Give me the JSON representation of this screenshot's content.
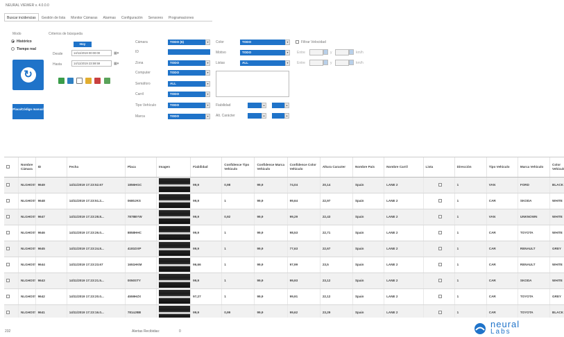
{
  "app": {
    "title": "NEURAL VIEWER v. 4.0.0.0"
  },
  "tabs": [
    "Buscar incidencias",
    "Gestión de lista",
    "Monitor Cámaras",
    "Alarmas",
    "Configuración",
    "Sensores",
    "Programaciones"
  ],
  "mode": {
    "group_label": "Modo",
    "options": [
      {
        "label": "Histórico",
        "selected": true
      },
      {
        "label": "Tiempo real",
        "selected": false
      }
    ]
  },
  "criteria": {
    "group_label": "Criterios de búsqueda",
    "today_button": "Hoy",
    "from_label": "Desde",
    "from_value": "14/11/2019 00:00:00",
    "to_label": "Hasta",
    "to_value": "14/11/2019 23:59:59",
    "camera_label": "Cámara",
    "camera_value": "TODO (6)",
    "id_label": "ID",
    "id_value": "",
    "zone_label": "Zona",
    "zone_value": "TODO",
    "computer_label": "Computer",
    "computer_value": "TODO",
    "traffic_light_label": "Semáforo",
    "traffic_light_value": "ALL",
    "lane_label": "Carril",
    "lane_value": "TODO",
    "vehicle_type_label": "Tipo Vehículo",
    "vehicle_type_value": "TODO",
    "brand_label": "Marca",
    "brand_value": "TODO",
    "color_label": "Color",
    "color_value": "TODO",
    "reason_label": "Motivo",
    "reason_value": "TODO",
    "lists_label": "Listas",
    "lists_value": "ALL",
    "speed_filter_label": "Filtrar Velocidad",
    "between_label": "Entre",
    "and_label": "y",
    "speed_unit": "km/h",
    "speed_min_1": "0",
    "speed_max_1": "0",
    "speed_min_2": "0",
    "speed_max_2": "0",
    "reliability_label": "Fiabilidad",
    "reliability_min": "0",
    "reliability_max": "100",
    "char_height_label": "Alt. Carácter",
    "char_height_min": "0",
    "char_height_max": "100",
    "plate_button": "Placa/Código manual"
  },
  "table": {
    "columns": [
      "Nombre Cámara",
      "ID",
      "Fecha",
      "Placa",
      "Imagen",
      "Fiabilidad",
      "Confidence Tipo Vehiculo",
      "Confidence Marca Vehiculo",
      "Confidence Color Vehiculo",
      "Altura Caracter",
      "Nombre País",
      "Nombre Carril",
      "Lista",
      "Dirección",
      "Tipo Vehiculo",
      "Marca Vehiculo",
      "Color Vehiculo"
    ],
    "rows": [
      [
        "NLGHOST1",
        "9649",
        "14/11/2019 17:23:52.67",
        "1856HGC",
        "",
        "99,9",
        "0,98",
        "99,9",
        "74,04",
        "20,14",
        "Spain",
        "LANE 2",
        "",
        "1",
        "VAN",
        "FORD",
        "BLACK"
      ],
      [
        "NLGHOST1",
        "9648",
        "14/11/2019 17:23:51.2...",
        "0680JKS",
        "",
        "99,9",
        "1",
        "99,9",
        "99,64",
        "22,97",
        "Spain",
        "LANE 2",
        "",
        "1",
        "CAR",
        "SKODA",
        "WHITE"
      ],
      [
        "NLGHOST1",
        "9647",
        "14/11/2019 17:23:28.8...",
        "7878BYW",
        "",
        "99,9",
        "0,92",
        "99,9",
        "99,29",
        "22,43",
        "Spain",
        "LANE 2",
        "",
        "1",
        "VAN",
        "UNKNOWN",
        "WHITE"
      ],
      [
        "NLGHOST1",
        "9646",
        "14/11/2019 17:23:26.0...",
        "8858HHC",
        "",
        "99,9",
        "1",
        "99,9",
        "98,53",
        "22,71",
        "Spain",
        "LANE 2",
        "",
        "1",
        "CAR",
        "TOYOTA",
        "WHITE"
      ],
      [
        "NLGHOST1",
        "9645",
        "14/11/2019 17:23:24.8...",
        "4181DXP",
        "",
        "99,9",
        "1",
        "99,9",
        "77,63",
        "22,67",
        "Spain",
        "LANE 2",
        "",
        "1",
        "CAR",
        "RENAULT",
        "GREY"
      ],
      [
        "NLGHOST1",
        "9644",
        "14/11/2019 17:23:23.67",
        "1651HKM",
        "",
        "96,66",
        "1",
        "99,9",
        "97,99",
        "23,5",
        "Spain",
        "LANE 2",
        "",
        "1",
        "CAR",
        "RENAULT",
        "WHITE"
      ],
      [
        "NLGHOST1",
        "9643",
        "14/11/2019 17:23:21.5...",
        "0050STY",
        "",
        "99,9",
        "1",
        "99,9",
        "99,93",
        "23,12",
        "Spain",
        "LANE 2",
        "",
        "1",
        "CAR",
        "SKODA",
        "WHITE"
      ],
      [
        "NLGHOST1",
        "9642",
        "14/11/2019 17:23:20.0...",
        "4559HZX",
        "",
        "97,27",
        "1",
        "99,9",
        "99,91",
        "22,12",
        "Spain",
        "LANE 2",
        "",
        "1",
        "CAR",
        "TOYOTA",
        "GREY"
      ],
      [
        "NLGHOST1",
        "9641",
        "14/11/2019 17:23:16.0...",
        "7814JBB",
        "",
        "99,9",
        "0,99",
        "99,9",
        "99,62",
        "23,29",
        "Spain",
        "LANE 2",
        "",
        "1",
        "CAR",
        "TOYOTA",
        "BLACK"
      ]
    ]
  },
  "status": {
    "count": "232",
    "alerts_label": "Alertas Recibidas:",
    "alerts_value": "0"
  },
  "logo": {
    "line1": "neural",
    "line2": "Labs"
  },
  "colors": {
    "accent": "#1f73c9"
  }
}
